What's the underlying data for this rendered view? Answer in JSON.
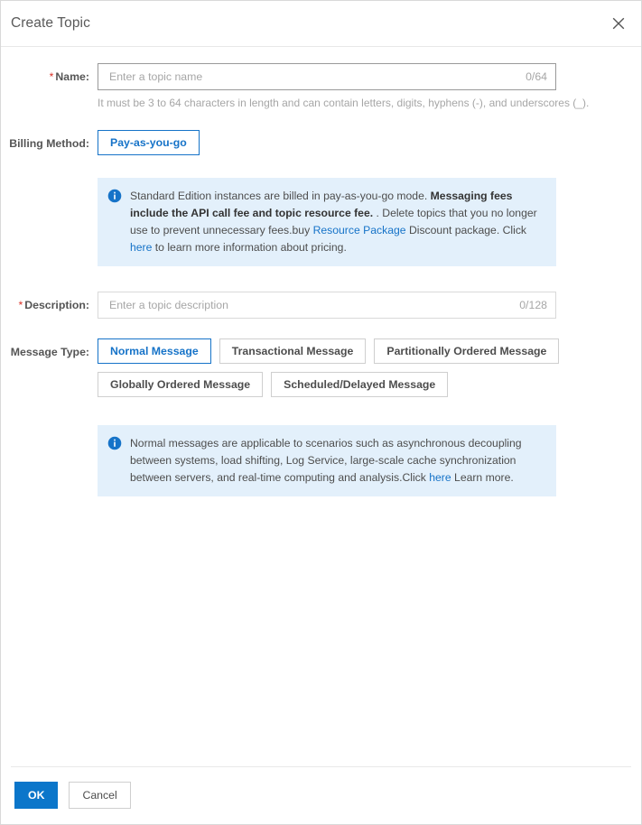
{
  "dialog": {
    "title": "Create Topic",
    "close_label": "Close"
  },
  "form": {
    "name": {
      "label": "Name:",
      "required": true,
      "placeholder": "Enter a topic name",
      "value": "",
      "counter": "0/64",
      "help": "It must be 3 to 64 characters in length and can contain letters, digits, hyphens (-), and underscores (_)."
    },
    "billing": {
      "label": "Billing Method:",
      "options": [
        {
          "label": "Pay-as-you-go",
          "selected": true
        }
      ],
      "alert": {
        "icon": "info-icon",
        "part1": "Standard Edition instances are billed in pay-as-you-go mode. ",
        "bold1": "Messaging fees include the API call fee and topic resource fee.",
        "part2": " . Delete topics that you no longer use to prevent unnecessary fees.buy ",
        "link1": "Resource Package",
        "part3": " Discount package. Click ",
        "link2": "here",
        "part4": " to learn more information about pricing."
      }
    },
    "description": {
      "label": "Description:",
      "required": true,
      "placeholder": "Enter a topic description",
      "value": "",
      "counter": "0/128"
    },
    "message_type": {
      "label": "Message Type:",
      "options": [
        {
          "label": "Normal Message",
          "selected": true
        },
        {
          "label": "Transactional Message",
          "selected": false
        },
        {
          "label": "Partitionally Ordered Message",
          "selected": false
        },
        {
          "label": "Globally Ordered Message",
          "selected": false
        },
        {
          "label": "Scheduled/Delayed Message",
          "selected": false
        }
      ],
      "alert": {
        "icon": "info-icon",
        "part1": "Normal messages are applicable to scenarios such as asynchronous decoupling between systems, load shifting, Log Service, large-scale cache synchronization between servers, and real-time computing and analysis.Click ",
        "link1": "here",
        "part2": " Learn more."
      }
    }
  },
  "footer": {
    "ok_label": "OK",
    "cancel_label": "Cancel"
  },
  "colors": {
    "accent": "#0b76ca",
    "link": "#1673c8",
    "required": "#d93026",
    "alert_bg": "#e3f0fb"
  }
}
